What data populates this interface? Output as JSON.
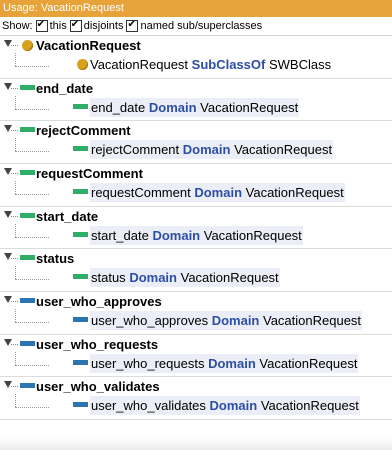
{
  "title": "Usage: VacationRequest",
  "show": {
    "prefix": "Show:",
    "options": [
      {
        "label": "this",
        "checked": true
      },
      {
        "label": "disjoints",
        "checked": true
      },
      {
        "label": "named sub/superclasses",
        "checked": true
      }
    ]
  },
  "groups": [
    {
      "head": "VacationRequest",
      "icon": "class-icon",
      "child": {
        "subject": "VacationRequest",
        "keyword": "SubClassOf",
        "object": "SWBClass"
      }
    },
    {
      "head": "end_date",
      "icon": "datatype-property-icon",
      "child": {
        "subject": "end_date",
        "keyword": "Domain",
        "object": "VacationRequest"
      }
    },
    {
      "head": "rejectComment",
      "icon": "datatype-property-icon",
      "child": {
        "subject": "rejectComment",
        "keyword": "Domain",
        "object": "VacationRequest"
      }
    },
    {
      "head": "requestComment",
      "icon": "datatype-property-icon",
      "child": {
        "subject": "requestComment",
        "keyword": "Domain",
        "object": "VacationRequest"
      }
    },
    {
      "head": "start_date",
      "icon": "datatype-property-icon",
      "child": {
        "subject": "start_date",
        "keyword": "Domain",
        "object": "VacationRequest"
      }
    },
    {
      "head": "status",
      "icon": "datatype-property-icon",
      "child": {
        "subject": "status",
        "keyword": "Domain",
        "object": "VacationRequest"
      }
    },
    {
      "head": "user_who_approves",
      "icon": "object-property-icon",
      "child": {
        "subject": "user_who_approves",
        "keyword": "Domain",
        "object": "VacationRequest"
      }
    },
    {
      "head": "user_who_requests",
      "icon": "object-property-icon",
      "child": {
        "subject": "user_who_requests",
        "keyword": "Domain",
        "object": "VacationRequest"
      }
    },
    {
      "head": "user_who_validates",
      "icon": "object-property-icon",
      "child": {
        "subject": "user_who_validates",
        "keyword": "Domain",
        "object": "VacationRequest"
      }
    }
  ],
  "colors": {
    "title_bar": "#e8a23a",
    "class_icon": "#d7a21a",
    "datatype_icon": "#2fae6a",
    "object_icon": "#2d74b3",
    "keyword": "#2c4fa3"
  }
}
